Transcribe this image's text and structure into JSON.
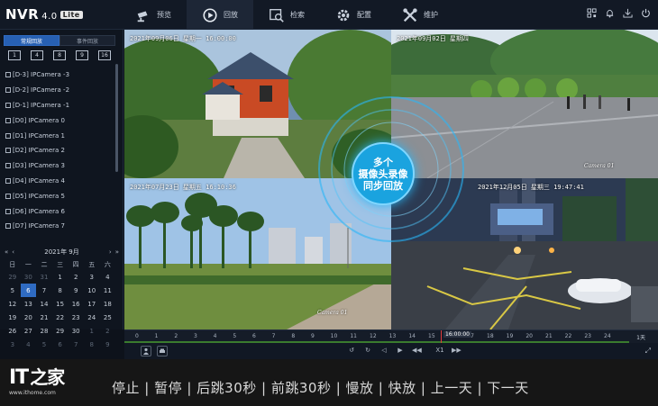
{
  "app": {
    "logo": "NVR",
    "version": "4.0",
    "edition": "Lite"
  },
  "menu": [
    {
      "label": "预览",
      "icon": "camera-icon"
    },
    {
      "label": "回放",
      "icon": "playback-icon",
      "active": true
    },
    {
      "label": "检索",
      "icon": "search-icon"
    },
    {
      "label": "配置",
      "icon": "gear-icon"
    },
    {
      "label": "维护",
      "icon": "tools-icon"
    }
  ],
  "top_tools": [
    "qr-icon",
    "bell-icon",
    "help-icon",
    "power-icon"
  ],
  "sidebar": {
    "tabs": [
      {
        "label": "常规回放",
        "active": true
      },
      {
        "label": "事件回放",
        "active": false
      }
    ],
    "split_options": [
      "1",
      "4",
      "8",
      "9",
      "16"
    ],
    "cameras": [
      "[D-3] IPCamera -3",
      "[D-2] IPCamera -2",
      "[D-1] IPCamera -1",
      "[D0] IPCamera 0",
      "[D1] IPCamera 1",
      "[D2] IPCamera 2",
      "[D3] IPCamera 3",
      "[D4] IPCamera 4",
      "[D5] IPCamera 5",
      "[D6] IPCamera 6",
      "[D7] IPCamera 7"
    ]
  },
  "calendar": {
    "title": "2021年 9月",
    "prev_year": "«",
    "prev_month": "‹",
    "next_month": "›",
    "next_year": "»",
    "weekdays": [
      "日",
      "一",
      "二",
      "三",
      "四",
      "五",
      "六"
    ],
    "days": [
      {
        "d": "29",
        "m": true
      },
      {
        "d": "30",
        "m": true
      },
      {
        "d": "31",
        "m": true
      },
      {
        "d": "1"
      },
      {
        "d": "2"
      },
      {
        "d": "3"
      },
      {
        "d": "4"
      },
      {
        "d": "5"
      },
      {
        "d": "6",
        "sel": true
      },
      {
        "d": "7"
      },
      {
        "d": "8"
      },
      {
        "d": "9"
      },
      {
        "d": "10"
      },
      {
        "d": "11"
      },
      {
        "d": "12"
      },
      {
        "d": "13"
      },
      {
        "d": "14"
      },
      {
        "d": "15"
      },
      {
        "d": "16"
      },
      {
        "d": "17"
      },
      {
        "d": "18"
      },
      {
        "d": "19"
      },
      {
        "d": "20"
      },
      {
        "d": "21"
      },
      {
        "d": "22"
      },
      {
        "d": "23"
      },
      {
        "d": "24"
      },
      {
        "d": "25"
      },
      {
        "d": "26"
      },
      {
        "d": "27"
      },
      {
        "d": "28"
      },
      {
        "d": "29"
      },
      {
        "d": "30"
      },
      {
        "d": "1",
        "m": true
      },
      {
        "d": "2",
        "m": true
      },
      {
        "d": "3",
        "m": true
      },
      {
        "d": "4",
        "m": true
      },
      {
        "d": "5",
        "m": true
      },
      {
        "d": "6",
        "m": true
      },
      {
        "d": "7",
        "m": true
      },
      {
        "d": "8",
        "m": true
      },
      {
        "d": "9",
        "m": true
      }
    ]
  },
  "tiles": {
    "tl_osd": "2021年09月06日 星期一 16:00:00",
    "tr_osd": "2021年09月02日 星期四",
    "tr_cam": "Camera 01",
    "bl_osd": "2021年07月23日 星期五 16:10:36",
    "bl_cam": "Camera 01",
    "br_osd": "2021年12月05日 星期三 19:47:41"
  },
  "overlay": {
    "line1": "多个",
    "line2": "摄像头录像",
    "line3": "同步回放"
  },
  "timeline": {
    "ticks": [
      "0",
      "1",
      "2",
      "3",
      "4",
      "5",
      "6",
      "7",
      "8",
      "9",
      "10",
      "11",
      "12",
      "13",
      "14",
      "15",
      "16",
      "17",
      "18",
      "19",
      "20",
      "21",
      "22",
      "23",
      "24"
    ],
    "current_time": "16:00:00",
    "scale": "1天",
    "speed": "X1"
  },
  "caption": {
    "brand": "IT",
    "brand_zh": "之家",
    "url": "www.ithome.com",
    "text": "停止 | 暂停 | 后跳30秒 | 前跳30秒 | 慢放 | 快放 | 上一天 | 下一天"
  }
}
